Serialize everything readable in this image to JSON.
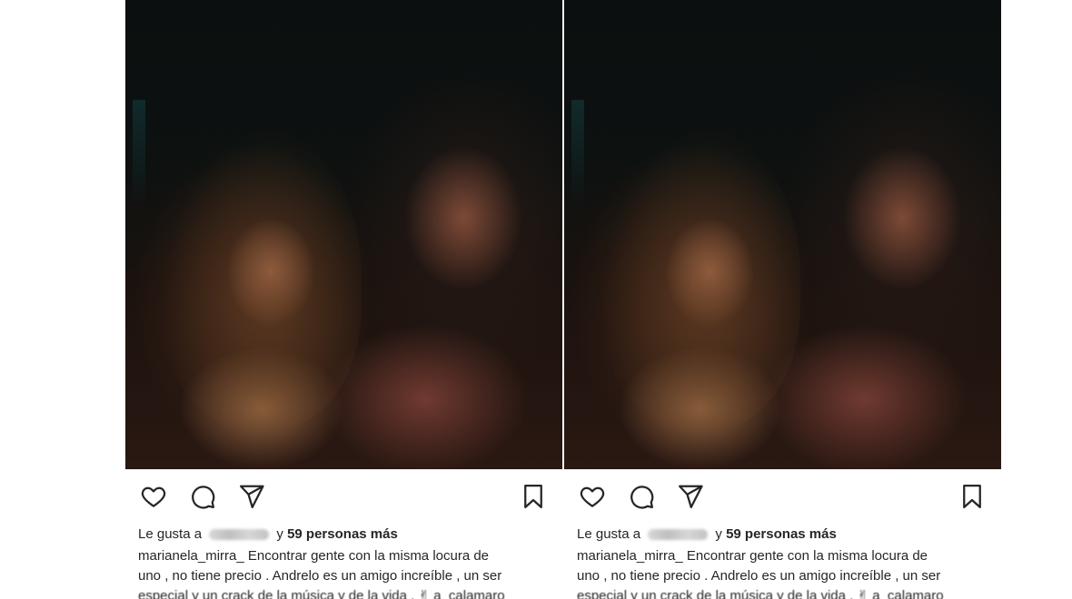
{
  "posts": [
    {
      "likes": {
        "prefix": "Le gusta a",
        "connector": "y",
        "count_text": "59 personas más"
      },
      "caption": {
        "username": "marianela_mirra_",
        "line1": "Encontrar gente con la misma locura de",
        "line2": "uno , no tiene precio . Andrelo es un amigo increíble , un ser",
        "line3": "especial y un crack de la música y de la vida . ✌ a_calamaro"
      }
    },
    {
      "likes": {
        "prefix": "Le gusta a",
        "connector": "y",
        "count_text": "59 personas más"
      },
      "caption": {
        "username": "marianela_mirra_",
        "line1": "Encontrar gente con la misma locura de",
        "line2": "uno , no tiene precio . Andrelo es un amigo increíble , un ser",
        "line3": "especial y un crack de la música y de la vida . ✌ a_calamaro"
      }
    }
  ],
  "icons": {
    "like": "heart-icon",
    "comment": "comment-icon",
    "share": "paper-plane-icon",
    "save": "bookmark-icon"
  },
  "colors": {
    "text": "#262626",
    "background": "#ffffff"
  }
}
